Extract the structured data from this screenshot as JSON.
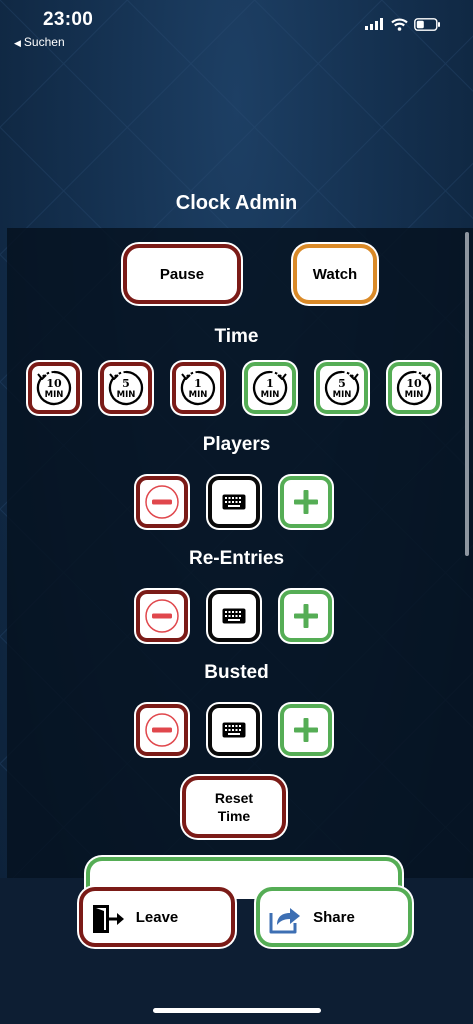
{
  "status_bar": {
    "time": "23:00",
    "back_label": "Suchen",
    "back_arrow": "◀"
  },
  "page": {
    "title": "Clock Admin"
  },
  "controls": {
    "pause_label": "Pause",
    "watch_label": "Watch"
  },
  "time_section": {
    "label": "Time",
    "buttons": [
      {
        "num": "10",
        "unit": "MIN",
        "direction": "back"
      },
      {
        "num": "5",
        "unit": "MIN",
        "direction": "back"
      },
      {
        "num": "1",
        "unit": "MIN",
        "direction": "back"
      },
      {
        "num": "1",
        "unit": "MIN",
        "direction": "forward"
      },
      {
        "num": "5",
        "unit": "MIN",
        "direction": "forward"
      },
      {
        "num": "10",
        "unit": "MIN",
        "direction": "forward"
      }
    ]
  },
  "players_section": {
    "label": "Players"
  },
  "reentries_section": {
    "label": "Re-Entries"
  },
  "busted_section": {
    "label": "Busted"
  },
  "reset": {
    "line1": "Reset",
    "line2": "Time"
  },
  "bottom": {
    "leave_label": "Leave",
    "share_label": "Share"
  },
  "colors": {
    "red": "#7b1b17",
    "green": "#55ad55",
    "orange": "#da8a28",
    "minus_red": "#e0474c",
    "plus_green": "#55ad55"
  },
  "icons": {
    "minus": "minus-icon",
    "plus": "plus-icon",
    "keyboard": "keyboard-icon",
    "leave": "door-exit-icon",
    "share": "share-arrow-icon"
  }
}
